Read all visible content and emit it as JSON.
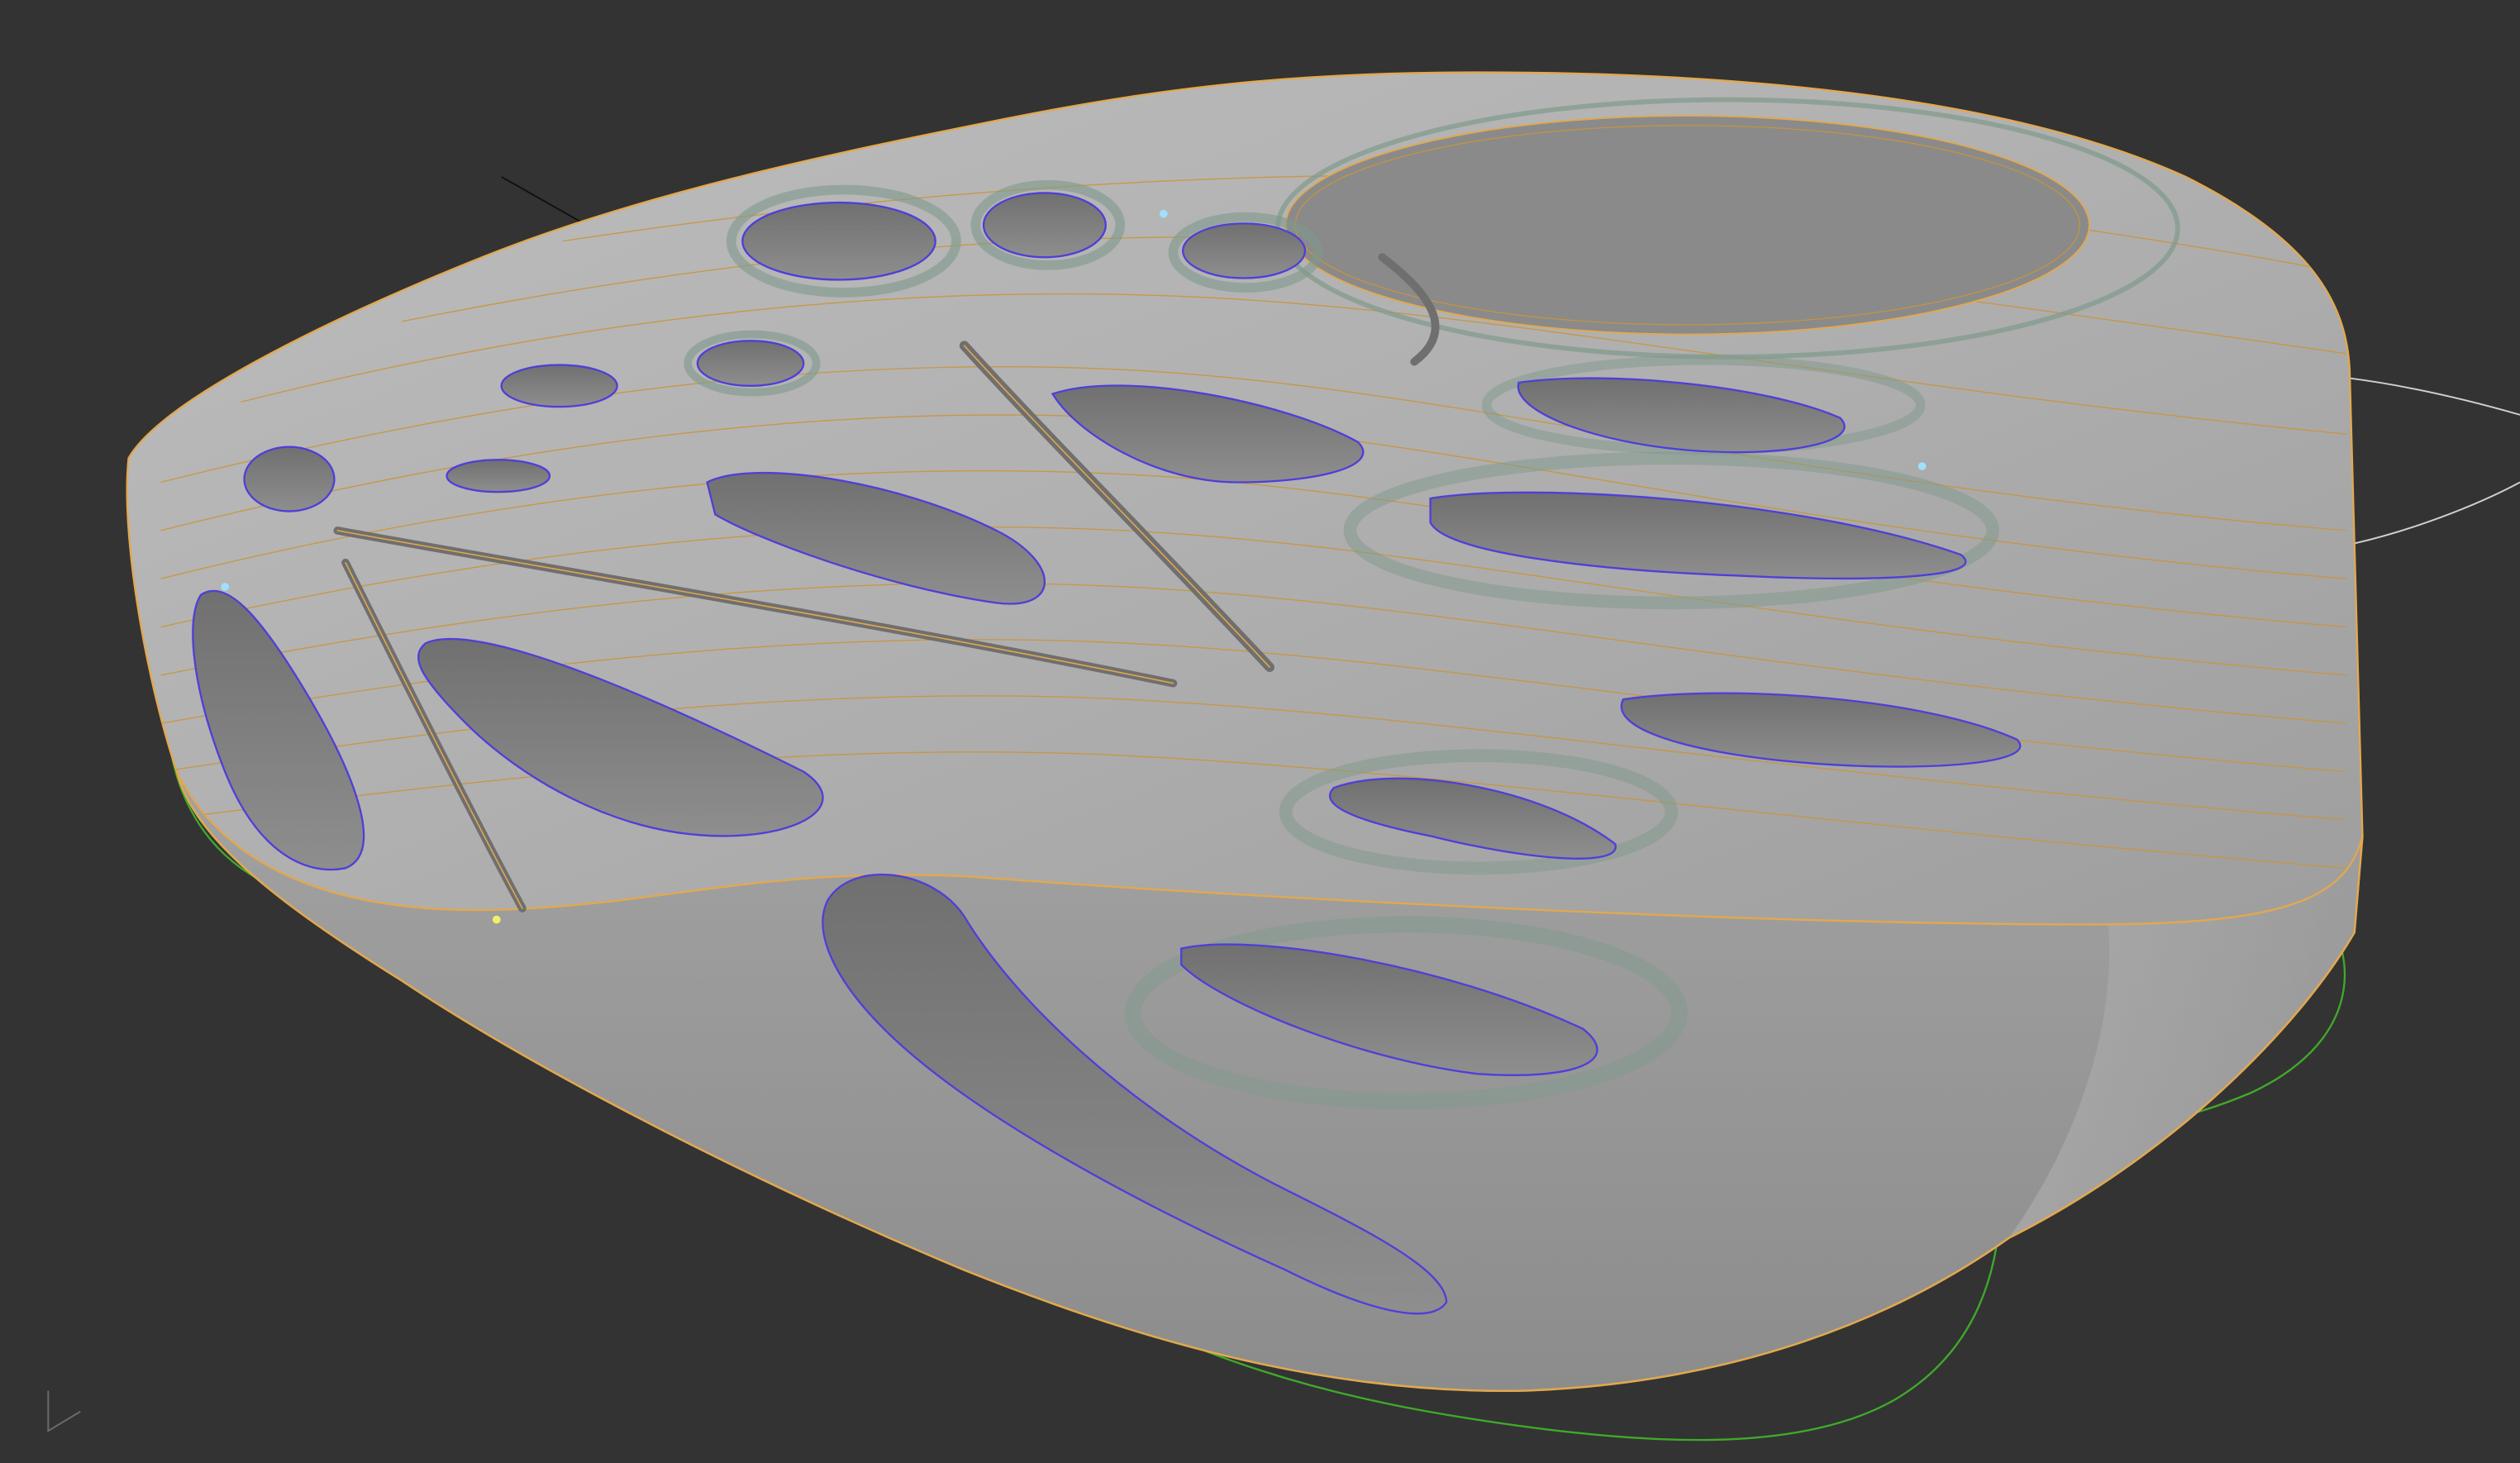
{
  "viewport": {
    "background": "#333333",
    "axis_gizmo": "axis-gizmo-icon"
  },
  "model": {
    "surface_color": "#a9a9a9",
    "surface_light": "#c4c4c4",
    "surface_dark": "#8a8a8a",
    "pocket_floor": "#858585",
    "pocket_shadow": "#6a6a6a",
    "contour_color": "#c9953a",
    "edge_color": "#e2a84e",
    "pocket_outline_color": "#4f3fd8",
    "fillet_color": "#7f9a8c",
    "guide_curve_color": "#3faa2a",
    "wire_color": "#d6d6d6",
    "vertex_color": "#9fe0ff"
  }
}
